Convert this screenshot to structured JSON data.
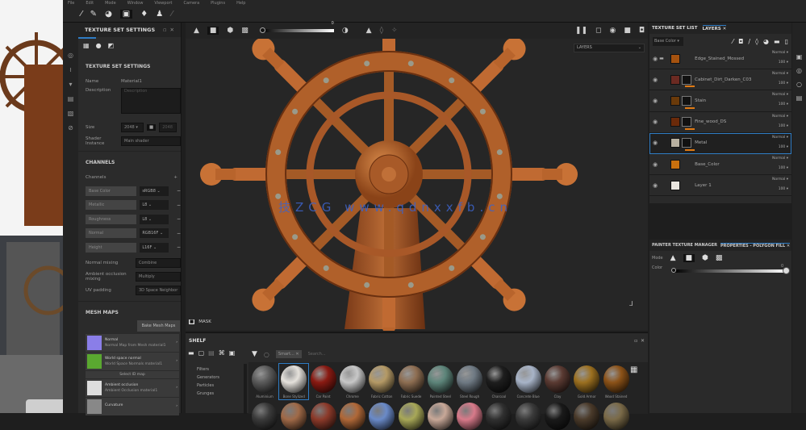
{
  "menu": [
    "File",
    "Edit",
    "Mode",
    "Window",
    "Viewport",
    "Camera",
    "Plugins",
    "Help"
  ],
  "watermark": "技ZCG www.qdnxxfb.cn",
  "texture_set_settings": {
    "panel_title": "TEXTURE SET SETTINGS",
    "section_title": "TEXTURE SET SETTINGS",
    "name_label": "Name",
    "name_value": "Material1",
    "description_label": "Description",
    "description_placeholder": "Description",
    "size_label": "Size",
    "size_value": "2048",
    "size_value2": "2048",
    "shader_label": "Shader Instance",
    "shader_value": "Main shader",
    "channels_title": "CHANNELS",
    "channels_label": "Channels",
    "channels": [
      {
        "name": "Base Color",
        "format": "sRGB8"
      },
      {
        "name": "Metallic",
        "format": "L8"
      },
      {
        "name": "Roughness",
        "format": "L8"
      },
      {
        "name": "Normal",
        "format": "RGB16F"
      },
      {
        "name": "Height",
        "format": "L16F"
      }
    ],
    "normal_mixing_label": "Normal mixing",
    "normal_mixing_value": "Combine",
    "ao_mixing_label": "Ambient occlusion mixing",
    "ao_mixing_value": "Multiply",
    "uv_padding_label": "UV padding",
    "uv_padding_value": "3D Space Neighbor",
    "mesh_maps_title": "MESH MAPS",
    "bake_button": "Bake Mesh Maps",
    "mesh_maps": [
      {
        "name": "Normal",
        "desc": "Normal Map from Mesh material1",
        "color": "#8a7ee8"
      },
      {
        "name": "World space normal",
        "desc": "World Space Normals material1",
        "color": "#5aa830"
      },
      {
        "name": "Select ID map",
        "desc": "",
        "color": ""
      },
      {
        "name": "Ambient occlusion",
        "desc": "Ambient Occlusion material1",
        "color": "#dddddd"
      },
      {
        "name": "Curvature",
        "desc": "",
        "color": "#888888"
      }
    ]
  },
  "viewport": {
    "exposure_value": "0",
    "display_mode": "LAYERS",
    "mask_label": "MASK"
  },
  "shelf": {
    "title": "SHELF",
    "filter_tag": "Smart...",
    "search_placeholder": "Search...",
    "categories": [
      "Filters",
      "Generators",
      "Particles",
      "Grunges"
    ],
    "materials": [
      {
        "name": "Aluminium",
        "color": "#5a5a5a"
      },
      {
        "name": "Bone Stylized",
        "color": "#e6e2dc"
      },
      {
        "name": "Car Paint",
        "color": "#8a1a12"
      },
      {
        "name": "Chrome",
        "color": "#c8c8c8"
      },
      {
        "name": "Fabric Cotton",
        "color": "#b59a66"
      },
      {
        "name": "Fabric Suede",
        "color": "#8e6e52"
      },
      {
        "name": "Painted Steel",
        "color": "#5d857a"
      },
      {
        "name": "Steel Rough",
        "color": "#6f7a84"
      },
      {
        "name": "Charcoal",
        "color": "#1e1e1e"
      },
      {
        "name": "Concrete Blue",
        "color": "#a8b4c8"
      },
      {
        "name": "Clay",
        "color": "#5a3a32"
      },
      {
        "name": "Gold Armor",
        "color": "#9c7020"
      },
      {
        "name": "Wood Stained",
        "color": "#8c5218"
      }
    ],
    "materials_row2": [
      "#3a3a3a",
      "#a06a48",
      "#8c3a2a",
      "#b06838",
      "#6a8ac8",
      "#a8a858",
      "#c8a898",
      "#d87a8a",
      "#303030",
      "#3a3a3a",
      "#1a1a1a",
      "#4a3a2a",
      "#7a6a48"
    ]
  },
  "layers_panel": {
    "tab_texture_set_list": "TEXTURE SET LIST",
    "tab_layers": "LAYERS",
    "channel_select": "Base Color",
    "layers": [
      {
        "name": "Edge_Stained_Mossed",
        "blend": "Normal",
        "opacity": "100",
        "color": "#a5520f",
        "mask": false,
        "selected": false,
        "folder": true
      },
      {
        "name": "Cabinet_Dirt_Darken_C03",
        "blend": "Normal",
        "opacity": "100",
        "color": "#6b2a22",
        "mask": true,
        "selected": false,
        "folder": false
      },
      {
        "name": "Stain",
        "blend": "Normal",
        "opacity": "100",
        "color": "#6a3a0a",
        "mask": true,
        "selected": false,
        "folder": false
      },
      {
        "name": "Fine_wood_DS",
        "blend": "Normal",
        "opacity": "100",
        "color": "#6a2a0a",
        "mask": true,
        "selected": false,
        "folder": false
      },
      {
        "name": "Metal",
        "blend": "Normal",
        "opacity": "100",
        "color": "#b8b0a0",
        "mask": true,
        "selected": true,
        "folder": false
      },
      {
        "name": "Base_Color",
        "blend": "Normal",
        "opacity": "100",
        "color": "#c8700e",
        "mask": false,
        "selected": false,
        "folder": false
      },
      {
        "name": "Layer 1",
        "blend": "Normal",
        "opacity": "100",
        "color": "#e8e4de",
        "mask": false,
        "selected": false,
        "folder": false
      }
    ]
  },
  "properties": {
    "tab_painter": "PAINTER TEXTURE MANAGER",
    "tab_properties": "PROPERTIES - POLYGON FILL",
    "mode_label": "Mode",
    "color_label": "Color",
    "color_value": "0",
    "color_level": 1.0
  },
  "accent": "#2f7cc4"
}
